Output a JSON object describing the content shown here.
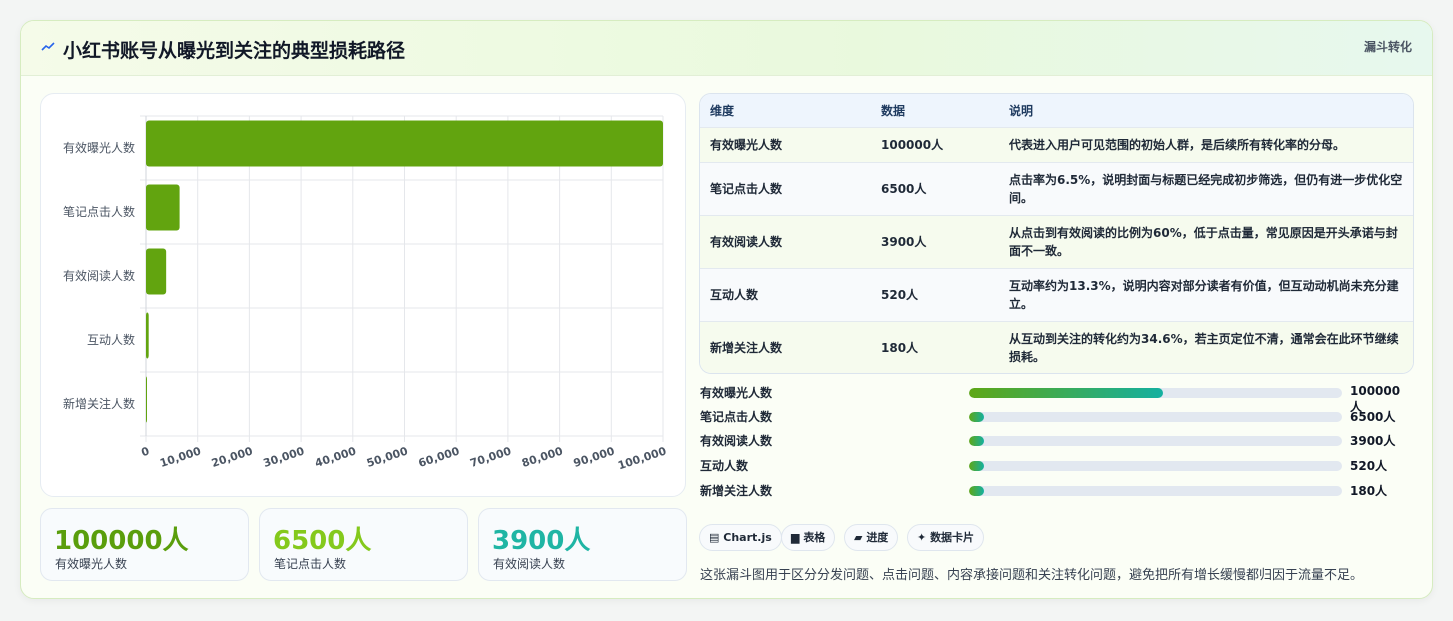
{
  "header": {
    "title": "小红书账号从曝光到关注的典型损耗路径",
    "tag": "漏斗转化"
  },
  "chart_data": {
    "type": "bar",
    "orientation": "horizontal",
    "categories": [
      "有效曝光人数",
      "笔记点击人数",
      "有效阅读人数",
      "互动人数",
      "新增关注人数"
    ],
    "values": [
      100000,
      6500,
      3900,
      520,
      180
    ],
    "xlim": [
      0,
      100000
    ],
    "x_ticks": [
      "0",
      "10,000",
      "20,000",
      "30,000",
      "40,000",
      "50,000",
      "60,000",
      "70,000",
      "80,000",
      "90,000",
      "100,000"
    ],
    "bar_color": "#62a40f",
    "grid": true
  },
  "stats": [
    {
      "value": "100000人",
      "label": "有效曝光人数",
      "color": "#5a9e0c"
    },
    {
      "value": "6500人",
      "label": "笔记点击人数",
      "color": "#84c91c"
    },
    {
      "value": "3900人",
      "label": "有效阅读人数",
      "color": "#1fb5a4"
    }
  ],
  "table": {
    "headers": [
      "维度",
      "数据",
      "说明"
    ],
    "rows": [
      {
        "dim": "有效曝光人数",
        "data": "100000人",
        "desc": "代表进入用户可见范围的初始人群，是后续所有转化率的分母。"
      },
      {
        "dim": "笔记点击人数",
        "data": "6500人",
        "desc": "点击率为6.5%，说明封面与标题已经完成初步筛选，但仍有进一步优化空间。"
      },
      {
        "dim": "有效阅读人数",
        "data": "3900人",
        "desc": "从点击到有效阅读的比例为60%，低于点击量，常见原因是开头承诺与封面不一致。"
      },
      {
        "dim": "互动人数",
        "data": "520人",
        "desc": "互动率约为13.3%，说明内容对部分读者有价值，但互动动机尚未充分建立。"
      },
      {
        "dim": "新增关注人数",
        "data": "180人",
        "desc": "从互动到关注的转化约为34.6%，若主页定位不清，通常会在此环节继续损耗。"
      }
    ]
  },
  "progress": [
    {
      "label": "有效曝光人数",
      "value": "100000人",
      "fraction": 0.52
    },
    {
      "label": "笔记点击人数",
      "value": "6500人",
      "fraction": 0.04
    },
    {
      "label": "有效阅读人数",
      "value": "3900人",
      "fraction": 0.04
    },
    {
      "label": "互动人数",
      "value": "520人",
      "fraction": 0.04
    },
    {
      "label": "新增关注人数",
      "value": "180人",
      "fraction": 0.04
    }
  ],
  "chips": [
    {
      "icon": "chart-icon",
      "label": "Chart.js"
    },
    {
      "icon": "table-icon",
      "label": "表格"
    },
    {
      "icon": "progress-icon",
      "label": "进度"
    },
    {
      "icon": "sparkle-icon",
      "label": "数据卡片"
    }
  ],
  "footnote": "这张漏斗图用于区分分发问题、点击问题、内容承接问题和关注转化问题，避免把所有增长缓慢都归因于流量不足。"
}
